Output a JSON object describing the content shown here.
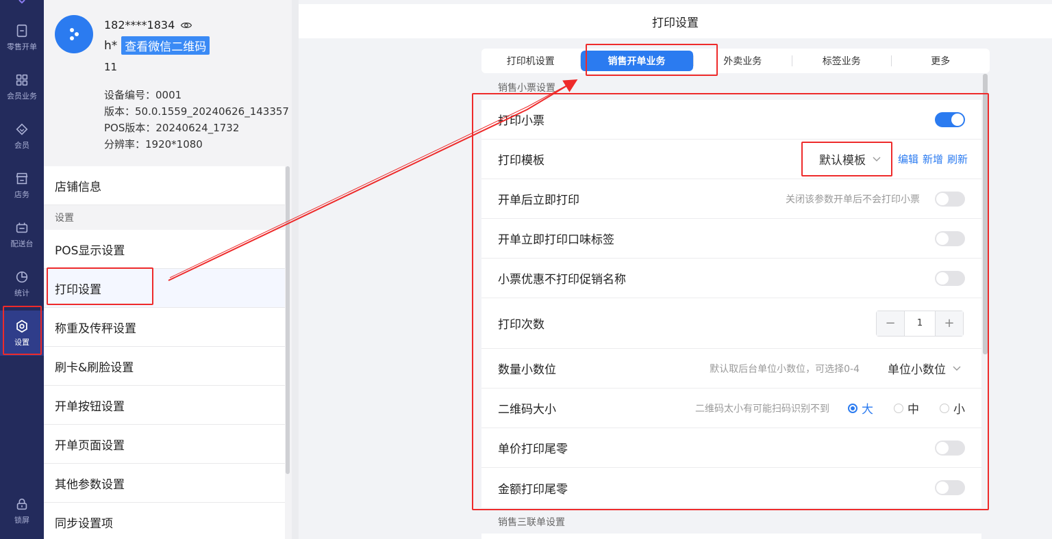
{
  "rail": {
    "items": [
      {
        "label": "零售开单",
        "icon": "receipt-icon"
      },
      {
        "label": "会员业务",
        "icon": "grid-icon"
      },
      {
        "label": "会员",
        "icon": "diamond-icon"
      },
      {
        "label": "店务",
        "icon": "store-icon"
      },
      {
        "label": "配送台",
        "icon": "delivery-icon"
      },
      {
        "label": "统计",
        "icon": "pie-chart-icon"
      },
      {
        "label": "设置",
        "icon": "gear-icon",
        "active": true
      },
      {
        "label": "锁屏",
        "icon": "lock-icon"
      }
    ]
  },
  "profile": {
    "phone": "182****1834",
    "name_prefix": "h*",
    "qr_link": "查看微信二维码",
    "code": "11",
    "device_no": "设备编号：0001",
    "version": "版本：50.0.1559_20240626_143357",
    "pos_version": "POS版本：20240624_1732",
    "resolution": "分辨率：1920*1080"
  },
  "menu": {
    "store_info": "店铺信息",
    "group_settings": "设置",
    "items": [
      "POS显示设置",
      "打印设置",
      "称重及传秤设置",
      "刷卡&刷脸设置",
      "开单按钮设置",
      "开单页面设置",
      "其他参数设置",
      "同步设置项"
    ]
  },
  "main": {
    "title": "打印设置",
    "tabs": [
      "打印机设置",
      "销售开单业务",
      "外卖业务",
      "标签业务",
      "更多"
    ],
    "section1": "销售小票设置",
    "section2": "销售三联单设置",
    "rows": {
      "print_receipt": "打印小票",
      "print_template": "打印模板",
      "template_value": "默认模板",
      "link_edit": "编辑",
      "link_add": "新增",
      "link_refresh": "刷新",
      "print_after_open": "开单后立即打印",
      "print_after_open_hint": "关闭该参数开单后不会打印小票",
      "print_taste_label": "开单立即打印口味标签",
      "no_promo_name": "小票优惠不打印促销名称",
      "print_count": "打印次数",
      "print_count_value": "1",
      "qty_decimal": "数量小数位",
      "qty_decimal_hint": "默认取后台单位小数位，可选择0-4",
      "qty_decimal_value": "单位小数位",
      "qr_size": "二维码大小",
      "qr_size_hint": "二维码太小有可能扫码识别不到",
      "qr_large": "大",
      "qr_medium": "中",
      "qr_small": "小",
      "unit_price_tail": "单价打印尾零",
      "amount_tail": "金额打印尾零"
    }
  },
  "colors": {
    "accent": "#2b7bf0",
    "rail_bg": "#232b5c",
    "annotation": "#ee2a2a"
  }
}
